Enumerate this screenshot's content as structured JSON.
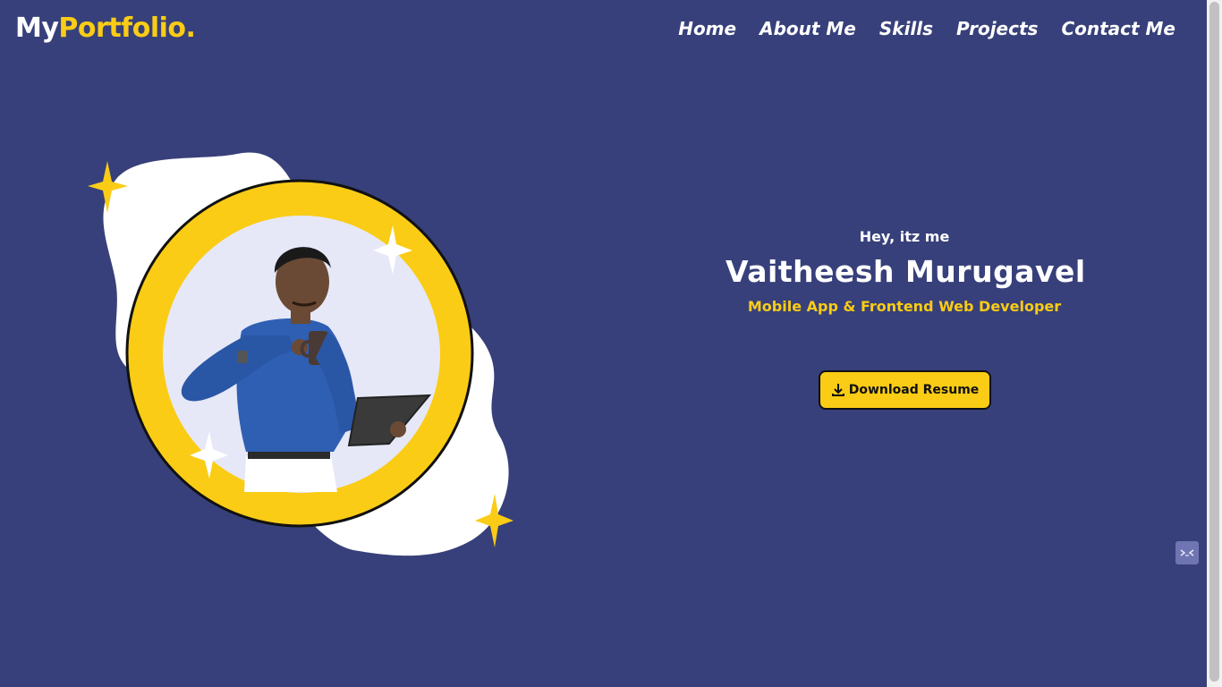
{
  "header": {
    "logo_main": "My",
    "logo_accent": "Portfolio.",
    "nav": [
      {
        "label": "Home"
      },
      {
        "label": "About Me"
      },
      {
        "label": "Skills"
      },
      {
        "label": "Projects"
      },
      {
        "label": "Contact Me"
      }
    ]
  },
  "hero": {
    "greeting": "Hey, itz me",
    "name": "Vaitheesh Murugavel",
    "role": "Mobile App & Frontend Web Developer",
    "download_label": "Download Resume",
    "download_icon": "download-icon",
    "portrait_icon": "profile-photo"
  },
  "widget": {
    "icon": "chat-widget-icon"
  },
  "colors": {
    "background": "#37407a",
    "accent": "#facc15",
    "text": "#ffffff"
  }
}
